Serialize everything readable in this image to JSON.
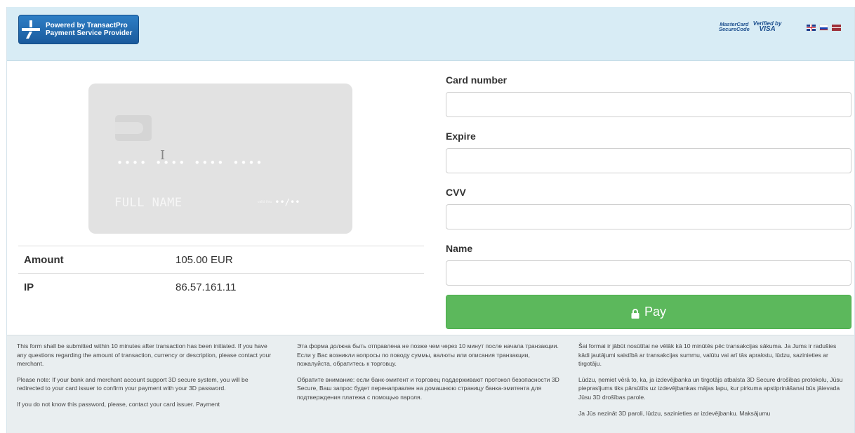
{
  "header": {
    "logo_line1": "Powered by TransactPro",
    "logo_line2": "Payment Service Provider",
    "mastercard_line1": "MasterCard",
    "mastercard_line2": "SecureCode",
    "visa_line1": "Verified by",
    "visa_line2": "VISA",
    "languages": [
      "en-flag",
      "ru-flag",
      "lv-flag"
    ]
  },
  "card_preview": {
    "number_placeholder": "•••• •••• •••• ••••",
    "name_placeholder": "FULL NAME",
    "expiry_small_left": "valid thru",
    "expiry_small_top": "month/year",
    "expiry_placeholder": "••/••"
  },
  "details": {
    "amount_label": "Amount",
    "amount_value": "105.00 EUR",
    "ip_label": "IP",
    "ip_value": "86.57.161.11"
  },
  "form": {
    "card_number_label": "Card number",
    "card_number_value": "",
    "expire_label": "Expire",
    "expire_value": "",
    "cvv_label": "CVV",
    "cvv_value": "",
    "name_label": "Name",
    "name_value": "",
    "pay_label": "Pay"
  },
  "colors": {
    "header_bg": "#d8ecf5",
    "pay_button": "#5cb85c",
    "logo_blue": "#1f67ad",
    "footer_bg": "#e9eef0"
  },
  "footer": {
    "en": [
      "This form shall be submitted within 10 minutes after transaction has been initiated. If you have any questions regarding the amount of transaction, currency or description, please contact your merchant.",
      "Please note: If your bank and merchant account support 3D secure system, you will be redirected to your card issuer to confirm your payment with your 3D password.",
      "If you do not know this password, please, contact your card issuer. Payment"
    ],
    "ru": [
      "Эта форма должна быть отправлена не позже чем через 10 минут после начала транзакции. Если у Вас возникли вопросы по поводу суммы, валюты или описания транзакции, пожалуйста, обратитесь к торговцу.",
      "Обратите внимание: если банк-эмитент и торговец поддерживают протокол безопасности 3D Secure, Ваш запрос будет перенаправлен на домашнюю страницу банка-эмитента для подтверждения платежа с помощью пароля.",
      ""
    ],
    "lv": [
      "Šai formai ir jābūt nosūtītai ne vēlāk kā 10 minūtēs pēc transakcijas sākuma. Ja Jums ir radušies kādi jautājumi saistībā ar transakcijas summu, valūtu vai arī tās aprakstu, lūdzu, sazinieties ar tirgotāju.",
      "Lūdzu, ņemiet vērā to, ka, ja izdevējbanka un tirgotājs atbalsta 3D Secure drošības protokolu, Jūsu pieprasījums tiks pārsūtīts uz izdevējbankas mājas lapu, kur pirkuma apstiprināšanai būs jāievada Jūsu 3D drošības parole.",
      "Ja Jūs nezināt 3D paroli, lūdzu, sazinieties ar izdevējbanku. Maksājumu"
    ]
  }
}
